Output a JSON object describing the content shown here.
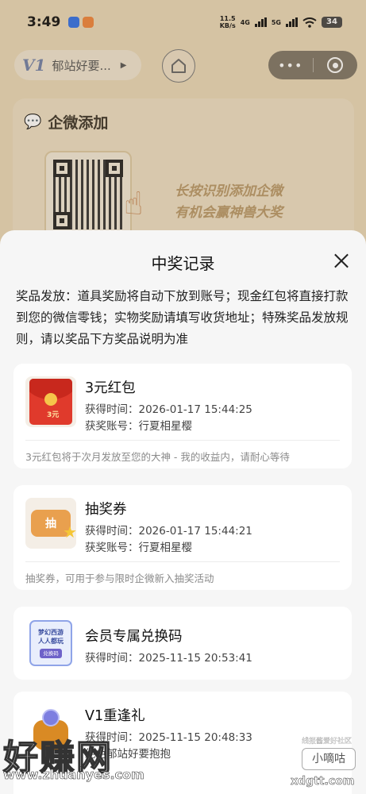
{
  "status_bar": {
    "time": "3:49",
    "net_speed": "11.5",
    "net_unit": "KB/s",
    "net_4g": "4G",
    "net_5g": "5G",
    "battery": "34"
  },
  "mini_program": {
    "logo_text": "V1",
    "name": "郁站好要...",
    "more_label": "•••"
  },
  "background_card": {
    "title": "企微添加",
    "hint_line1": "长按识别添加企微",
    "hint_line2": "有机会赢神兽大奖"
  },
  "sheet": {
    "title": "中奖记录",
    "notice": "奖品发放：道具奖励将自动下放到账号；现金红包将直接打款到您的微信零钱；实物奖励请填写收货地址；特殊奖品发放规则，请以奖品下方奖品说明为准",
    "records": [
      {
        "name": "3元红包",
        "time_label": "获得时间：",
        "time": "2026-01-17 15:44:25",
        "account_label": "获奖账号：",
        "account": "行夏相星樱",
        "desc": "3元红包将于次月发放至您的大神 - 我的收益内，请耐心等待",
        "thumb_text": "3元"
      },
      {
        "name": "抽奖券",
        "time_label": "获得时间：",
        "time": "2026-01-17 15:44:21",
        "account_label": "获奖账号：",
        "account": "行夏相星樱",
        "desc": "抽奖券，可用于参与限时企微新入抽奖活动",
        "thumb_text": "抽"
      },
      {
        "name": "会员专属兑换码",
        "time_label": "获得时间：",
        "time": "2025-11-15 20:53:41",
        "thumb_line1": "梦幻西游",
        "thumb_line2": "人人都玩",
        "thumb_tag": "兑换码"
      },
      {
        "name": "V1重逢礼",
        "time_label": "获得时间：",
        "time": "2025-11-15 20:48:33",
        "account_partial": "绝色郁站好要抱抱"
      }
    ]
  },
  "watermarks": {
    "big": "好赚网",
    "url": "www.zhuanyes.com",
    "small_top": "线报酱爱好社区",
    "box": "小嘀咕",
    "right": "xdgtt.com"
  },
  "colors": {
    "sheet_bg": "#f6f6f6",
    "page_bg": "#e9d8b8",
    "capsule": "#7d7566"
  }
}
